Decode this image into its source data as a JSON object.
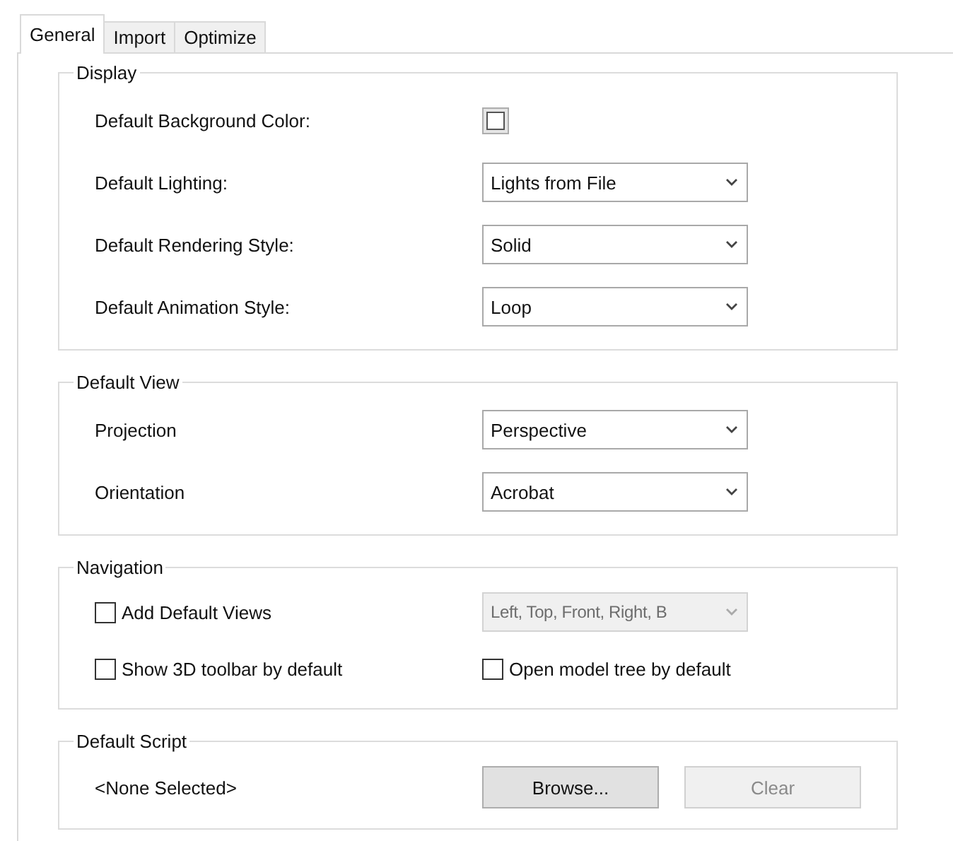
{
  "tabs": [
    {
      "label": "General",
      "selected": true
    },
    {
      "label": "Import",
      "selected": false
    },
    {
      "label": "Optimize",
      "selected": false
    }
  ],
  "groups": [
    {
      "title": "Display",
      "rows": [
        {
          "kind": "color",
          "label": "Default Background Color:"
        },
        {
          "kind": "select",
          "label": "Default Lighting:",
          "value": "Lights from File"
        },
        {
          "kind": "select",
          "label": "Default Rendering Style:",
          "value": "Solid"
        },
        {
          "kind": "select",
          "label": "Default Animation Style:",
          "value": "Loop"
        }
      ]
    },
    {
      "title": "Default View",
      "rows": [
        {
          "kind": "select",
          "label": "Projection",
          "value": "Perspective"
        },
        {
          "kind": "select",
          "label": "Orientation",
          "value": "Acrobat"
        }
      ]
    },
    {
      "title": "Navigation",
      "rows": [
        {
          "kind": "check_select",
          "check": {
            "label": "Add Default Views",
            "checked": false
          },
          "select": {
            "value": "Left, Top, Front, Right, B",
            "disabled": true
          }
        },
        {
          "kind": "check_pair",
          "checks": [
            {
              "label": "Show 3D toolbar by default",
              "checked": false
            },
            {
              "label": "Open model tree by default",
              "checked": false
            }
          ]
        }
      ]
    },
    {
      "title": "Default Script",
      "rows": [
        {
          "kind": "script",
          "label": "<None Selected>",
          "buttons": [
            {
              "label": "Browse...",
              "disabled": false
            },
            {
              "label": "Clear",
              "disabled": true
            }
          ]
        }
      ]
    }
  ]
}
